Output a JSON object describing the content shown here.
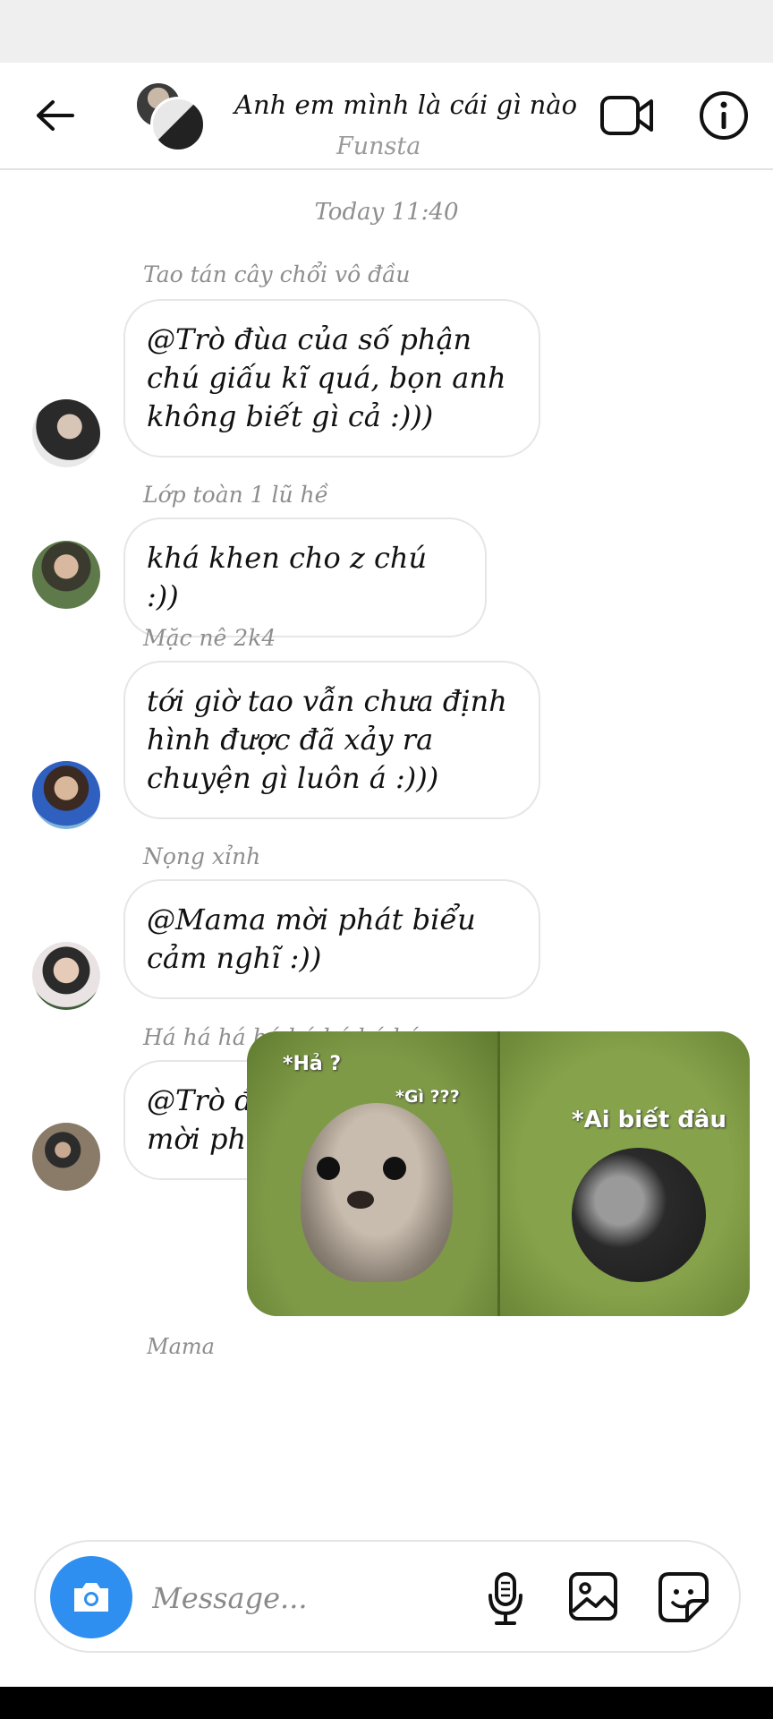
{
  "header": {
    "title": "Anh em mình là cái gì nào",
    "subtitle": "Funsta"
  },
  "timestamp": "Today 11:40",
  "messages": [
    {
      "sender": "Tao tán cây chổi vô đầu",
      "lines": [
        "@Trò đùa của số phận",
        "chú giấu kĩ quá, bọn anh",
        "không biết gì cả :)))"
      ]
    },
    {
      "sender": "Lớp toàn 1 lũ hề",
      "lines": [
        "khá khen cho z chú :))"
      ]
    },
    {
      "sender": "Mặc nê 2k4",
      "lines": [
        "tới giờ tao vẫn chưa định",
        "hình được đã xảy ra",
        "chuyện gì luôn á :)))"
      ]
    },
    {
      "sender": "Nọng xỉnh",
      "lines": [
        "@Mama mời phát biểu",
        "cảm nghĩ :))"
      ]
    },
    {
      "sender": "Há há há há há há há há",
      "lines": [
        "@Trò đùa của số phận",
        "mời phát biểu cảm nghĩ"
      ]
    }
  ],
  "image_message": {
    "caption_left_1": "*Hả ?",
    "caption_left_2": "*Gì ???",
    "caption_right": "*Ai biết đâu"
  },
  "partial_sender": "Mama",
  "composer": {
    "placeholder": "Message..."
  },
  "colors": {
    "accent": "#2f8ff0",
    "meta_text": "#8e8e8e",
    "bubble_border": "#e6e6e6"
  },
  "icons": {
    "back": "arrow-left-icon",
    "video": "video-camera-icon",
    "info": "info-icon",
    "camera": "camera-icon",
    "mic": "microphone-icon",
    "gallery": "image-icon",
    "sticker": "sticker-icon"
  }
}
